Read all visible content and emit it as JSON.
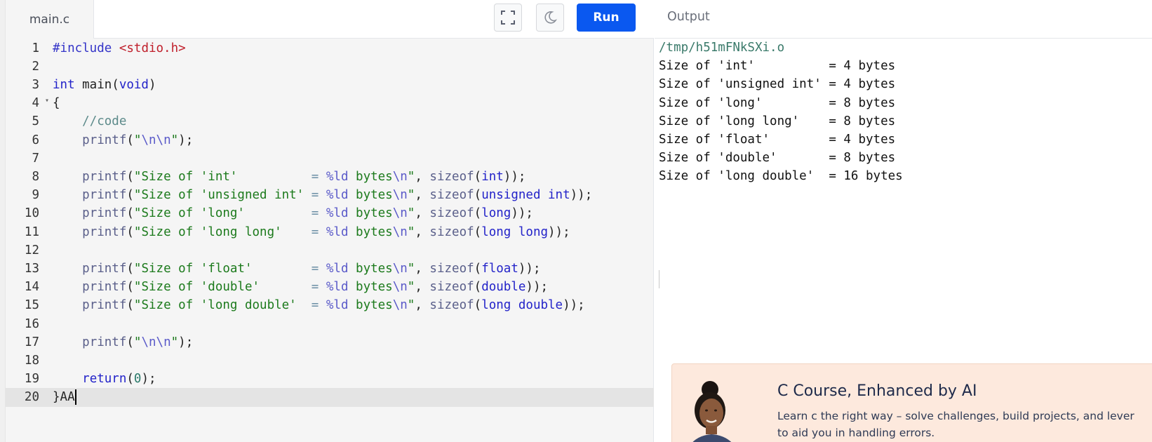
{
  "editor": {
    "file_tab": "main.c",
    "run_label": "Run",
    "toolbar_icons": [
      "fullscreen-icon",
      "moon-icon"
    ],
    "lines": [
      {
        "n": "1"
      },
      {
        "n": "2"
      },
      {
        "n": "3"
      },
      {
        "n": "4"
      },
      {
        "n": "5"
      },
      {
        "n": "6"
      },
      {
        "n": "7"
      },
      {
        "n": "8"
      },
      {
        "n": "9"
      },
      {
        "n": "10"
      },
      {
        "n": "11"
      },
      {
        "n": "12"
      },
      {
        "n": "13"
      },
      {
        "n": "14"
      },
      {
        "n": "15"
      },
      {
        "n": "16"
      },
      {
        "n": "17"
      },
      {
        "n": "18"
      },
      {
        "n": "19"
      },
      {
        "n": "20"
      }
    ],
    "code": [
      "#include <stdio.h>",
      "",
      "int main(void)",
      "{",
      "    //code",
      "    printf(\"\\n\\n\");",
      "",
      "    printf(\"Size of 'int'          = %ld bytes\\n\", sizeof(int));",
      "    printf(\"Size of 'unsigned int' = %ld bytes\\n\", sizeof(unsigned int));",
      "    printf(\"Size of 'long'         = %ld bytes\\n\", sizeof(long));",
      "    printf(\"Size of 'long long'    = %ld bytes\\n\", sizeof(long long));",
      "",
      "    printf(\"Size of 'float'        = %ld bytes\\n\", sizeof(float));",
      "    printf(\"Size of 'double'       = %ld bytes\\n\", sizeof(double));",
      "    printf(\"Size of 'long double'  = %ld bytes\\n\", sizeof(long double));",
      "",
      "    printf(\"\\n\\n\");",
      "",
      "    return(0);",
      "}AA"
    ],
    "active_line": 20
  },
  "output": {
    "title": "Output",
    "path": "/tmp/h51mFNkSXi.o",
    "lines": [
      "Size of 'int'          = 4 bytes",
      "Size of 'unsigned int' = 4 bytes",
      "Size of 'long'         = 8 bytes",
      "Size of 'long long'    = 8 bytes",
      "Size of 'float'        = 4 bytes",
      "Size of 'double'       = 8 bytes",
      "Size of 'long double'  = 16 bytes"
    ]
  },
  "promo": {
    "title": "C Course, Enhanced by AI",
    "desc_line1": "Learn c the right way – solve challenges, build projects, and lever",
    "desc_line2": "to aid you in handling errors.",
    "background": "#fde9dd"
  },
  "colors": {
    "run_button": "#0a58f0",
    "keyword": "#2323c9",
    "string": "#1c7a1c"
  }
}
